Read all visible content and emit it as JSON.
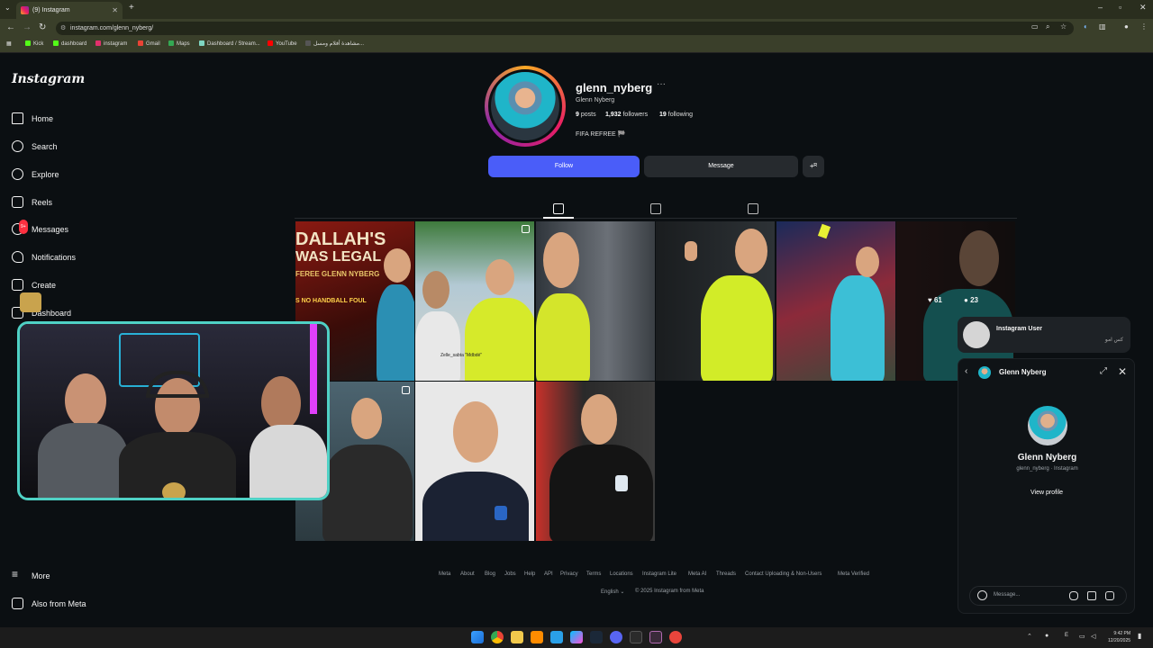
{
  "browser": {
    "tab_title": "(9) Instagram",
    "url": "instagram.com/glenn_nyberg/",
    "bookmarks": [
      "Kick",
      "dashboard",
      "instagram",
      "Gmail",
      "Maps",
      "Dashboard / Stream...",
      "YouTube",
      "مشاهدة أفلام ومسل..."
    ]
  },
  "sidebar": {
    "logo": "Instagram",
    "items": [
      {
        "label": "Home",
        "icon": "home-icon"
      },
      {
        "label": "Search",
        "icon": "search-icon"
      },
      {
        "label": "Explore",
        "icon": "compass-icon"
      },
      {
        "label": "Reels",
        "icon": "reels-icon"
      },
      {
        "label": "Messages",
        "icon": "messenger-icon",
        "badge": "9+"
      },
      {
        "label": "Notifications",
        "icon": "heart-icon"
      },
      {
        "label": "Create",
        "icon": "plus-icon"
      },
      {
        "label": "Dashboard",
        "icon": "chart-icon"
      }
    ],
    "more": "More",
    "also_from_meta": "Also from Meta"
  },
  "profile": {
    "username": "glenn_nyberg",
    "more": "···",
    "full_name": "Glenn Nyberg",
    "posts_count": "9",
    "posts_label": "posts",
    "followers_count": "1,932",
    "followers_label": "followers",
    "following_count": "19",
    "following_label": "following",
    "bio": "FIFA REFREE 🏁",
    "follow_label": "Follow",
    "message_label": "Message",
    "adduser_label": "+ᴿ"
  },
  "grid": {
    "post1_line1": "DALLAH'S",
    "post1_line2": "WAS LEGAL",
    "post1_line3": "FEREE GLENN NYBERG",
    "post1_line4": "S NO HANDBALL FOUL",
    "post2_caption": "Zelle_sabta \"Mdbdé\"",
    "hover_likes": "61",
    "hover_comments": "23"
  },
  "footer": {
    "links": [
      "Meta",
      "About",
      "Blog",
      "Jobs",
      "Help",
      "API",
      "Privacy",
      "Terms",
      "Locations",
      "Instagram Lite",
      "Meta AI",
      "Threads",
      "Contact Uploading & Non-Users",
      "Meta Verified"
    ],
    "language": "English",
    "copyright": "© 2025 Instagram from Meta"
  },
  "notification": {
    "name": "Instagram User",
    "message": "كس امو"
  },
  "chat": {
    "title": "Glenn Nyberg",
    "name": "Glenn Nyberg",
    "subtitle": "glenn_nyberg · Instagram",
    "view_profile": "View profile",
    "placeholder": "Message..."
  },
  "taskbar": {
    "lang": "E",
    "time": "9:42 PM",
    "date": "12/20/2025"
  }
}
